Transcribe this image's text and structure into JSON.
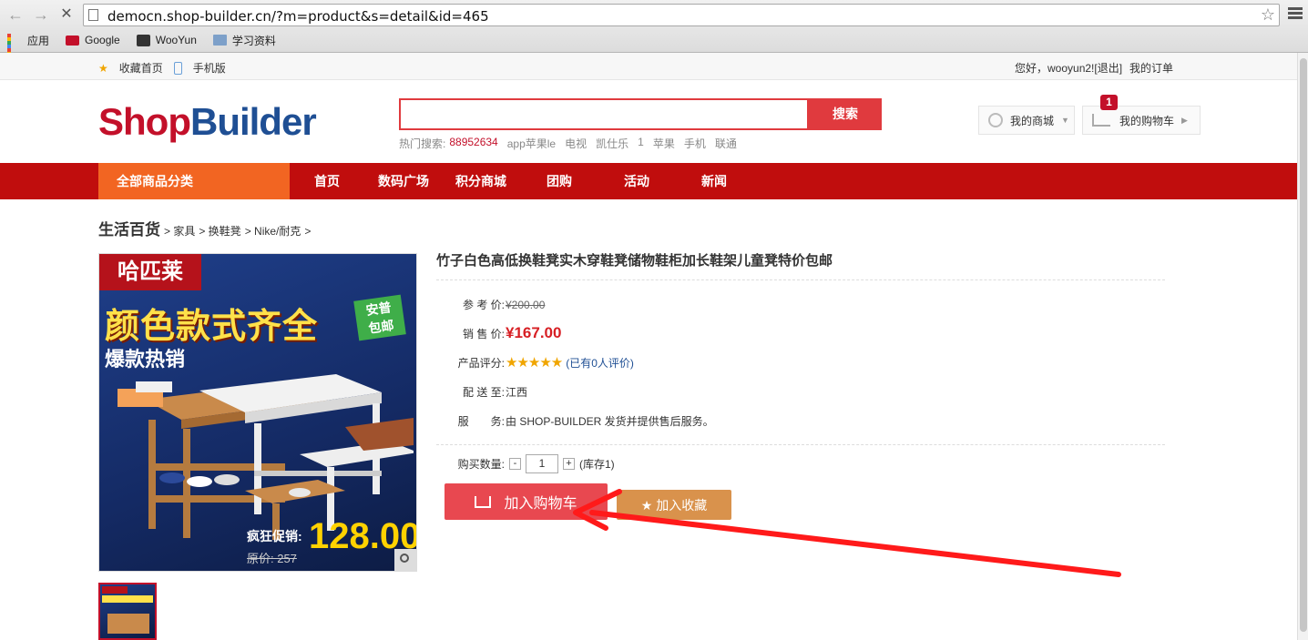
{
  "browser": {
    "url": "democn.shop-builder.cn/?m=product&s=detail&id=465",
    "bookmarks": [
      "应用",
      "Google",
      "WooYun",
      "学习资料"
    ]
  },
  "topbar": {
    "favorite": "收藏首页",
    "mobile": "手机版",
    "greeting": "您好，wooyun2![退出]",
    "orders": "我的订单"
  },
  "header": {
    "logo_part1": "Shop",
    "logo_part2": "Builder",
    "search_placeholder": "",
    "search_button": "搜索",
    "hot_label": "热门搜索:",
    "hot_terms": [
      "88952634",
      "app苹果le",
      "电视",
      "凯仕乐",
      "1",
      "苹果",
      "手机",
      "联通"
    ],
    "my_mall": "我的商城",
    "my_cart": "我的购物车",
    "cart_count": "1"
  },
  "nav": {
    "all_categories": "全部商品分类",
    "items": [
      "首页",
      "数码广场",
      "积分商城",
      "团购",
      "活动",
      "新闻"
    ]
  },
  "breadcrumb": {
    "root": "生活百货",
    "items": [
      "> 家具",
      "> 换鞋凳",
      "> Nike/耐克",
      ">"
    ]
  },
  "product_image": {
    "brand": "哈匹莱",
    "headline": "颜色款式齐全",
    "badge": "包邮",
    "badge_top": "安普",
    "hot_sale": "爆款热销",
    "promo_label": "疯狂促销:",
    "promo_price": "128.00",
    "orig_price": "原价: 257"
  },
  "product": {
    "title": "竹子白色高低换鞋凳实木穿鞋凳储物鞋柜加长鞋架儿童凳特价包邮",
    "ref_price_label": "参 考 价:",
    "ref_price": "¥200.00",
    "sale_price_label": "销 售 价:",
    "sale_price": "¥167.00",
    "rating_label": "产品评分:",
    "stars": "★★★★★",
    "reviews": "(已有0人评价)",
    "ship_label": "配 送 至:",
    "ship_to": "江西",
    "service_label": "服　　务:",
    "service": "由 SHOP-BUILDER 发货并提供售后服务。",
    "qty_label": "购买数量:",
    "qty_minus": "-",
    "qty_value": "1",
    "qty_plus": "+",
    "stock": "(库存1)",
    "add_to_cart": "加入购物车",
    "add_to_fav": "★ 加入收藏"
  },
  "colors": {
    "brand_red": "#c00d0d",
    "accent_orange": "#f26522",
    "cart_button": "#e84850",
    "fav_button": "#d9924c",
    "annotation_arrow": "#ff1a1a"
  }
}
